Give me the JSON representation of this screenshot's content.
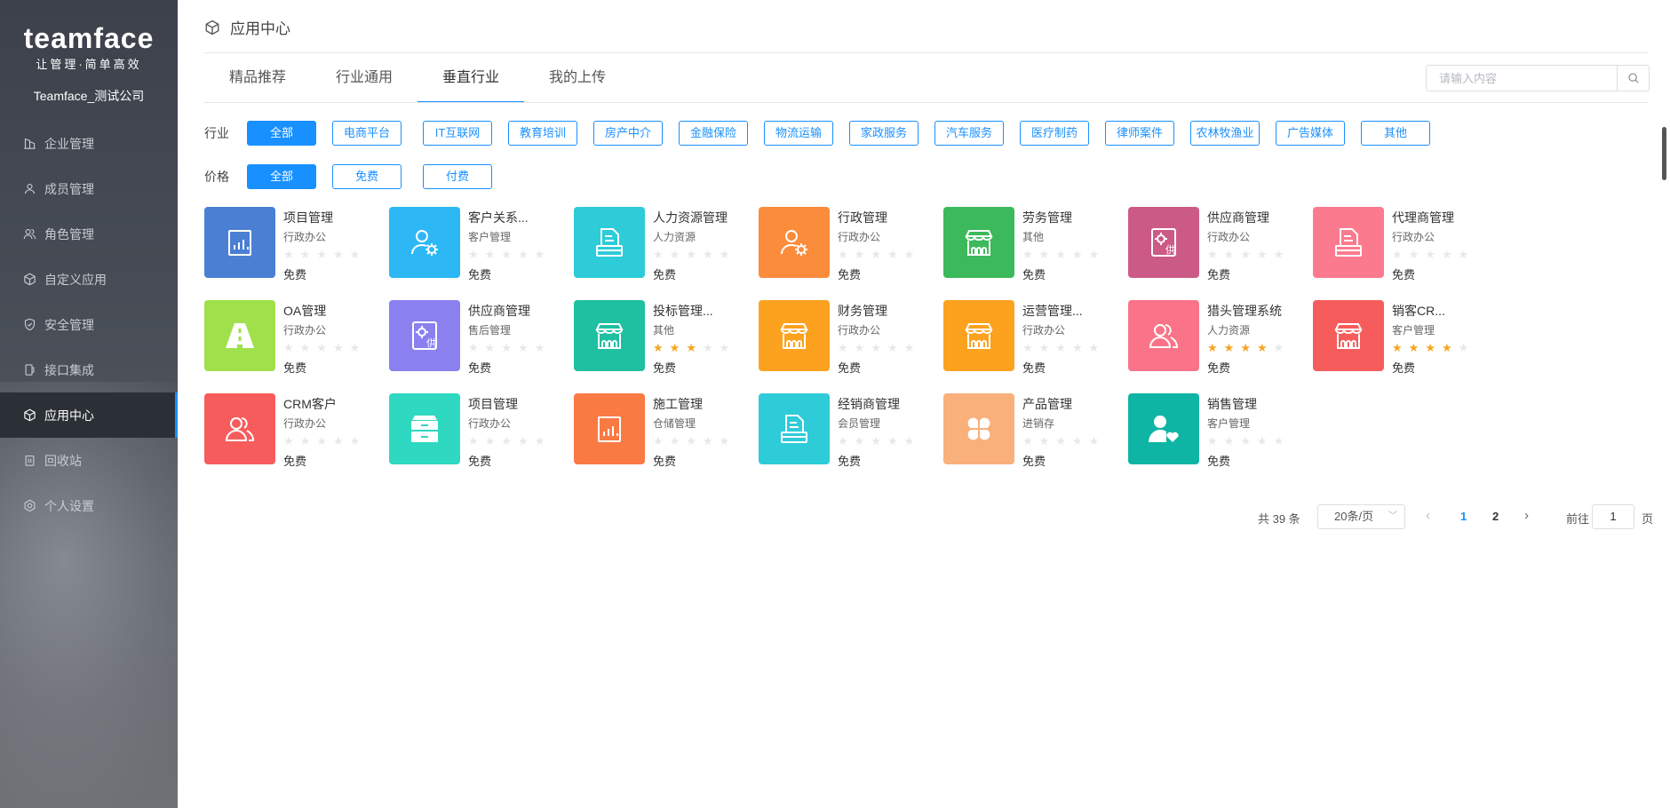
{
  "sidebar": {
    "logo": "teamface",
    "slogan": "让管理·简单高效",
    "company": "Teamface_测试公司",
    "items": [
      {
        "label": "企业管理",
        "icon": "building-icon"
      },
      {
        "label": "成员管理",
        "icon": "user-icon"
      },
      {
        "label": "角色管理",
        "icon": "users-icon"
      },
      {
        "label": "自定义应用",
        "icon": "cube-icon"
      },
      {
        "label": "安全管理",
        "icon": "shield-icon"
      },
      {
        "label": "接口集成",
        "icon": "plug-icon"
      },
      {
        "label": "应用中心",
        "icon": "cube-icon",
        "active": true
      },
      {
        "label": "回收站",
        "icon": "trash-icon"
      },
      {
        "label": "个人设置",
        "icon": "gear-icon"
      }
    ]
  },
  "header": {
    "title": "应用中心",
    "icon": "cube-icon"
  },
  "tabs": [
    "精品推荐",
    "行业通用",
    "垂直行业",
    "我的上传"
  ],
  "active_tab": "垂直行业",
  "search": {
    "placeholder": "请输入内容",
    "icon": "search-icon"
  },
  "filters": {
    "industry_label": "行业",
    "industry_options": [
      "全部",
      "电商平台",
      "IT互联网",
      "教育培训",
      "房产中介",
      "金融保险",
      "物流运输",
      "家政服务",
      "汽车服务",
      "医疗制药",
      "律师案件",
      "农林牧渔业",
      "广告媒体",
      "其他"
    ],
    "industry_selected": "全部",
    "price_label": "价格",
    "price_options": [
      "全部",
      "免费",
      "付费"
    ],
    "price_selected": "全部"
  },
  "apps": [
    {
      "name": "项目管理",
      "category": "行政办公",
      "rating": 0,
      "price": "免费",
      "color": "#4a7fd4",
      "icon": "report-icon"
    },
    {
      "name": "客户关系...",
      "category": "客户管理",
      "rating": 0,
      "price": "免费",
      "color": "#2db7f5",
      "icon": "user-gear-icon"
    },
    {
      "name": "人力资源管理",
      "category": "人力资源",
      "rating": 0,
      "price": "免费",
      "color": "#2ecbd8",
      "icon": "document-icon"
    },
    {
      "name": "行政管理",
      "category": "行政办公",
      "rating": 0,
      "price": "免费",
      "color": "#fa8c3c",
      "icon": "user-gear-icon"
    },
    {
      "name": "劳务管理",
      "category": "其他",
      "rating": 0,
      "price": "免费",
      "color": "#3cb95a",
      "icon": "store-icon"
    },
    {
      "name": "供应商管理",
      "category": "行政办公",
      "rating": 0,
      "price": "免费",
      "color": "#cc5a87",
      "icon": "supplier-icon"
    },
    {
      "name": "代理商管理",
      "category": "行政办公",
      "rating": 0,
      "price": "免费",
      "color": "#fc7a8e",
      "icon": "document-icon"
    },
    {
      "name": "OA管理",
      "category": "行政办公",
      "rating": 0,
      "price": "免费",
      "color": "#a0e04b",
      "icon": "road-icon"
    },
    {
      "name": "供应商管理",
      "category": "售后管理",
      "rating": 0,
      "price": "免费",
      "color": "#8b80f0",
      "icon": "supplier-icon"
    },
    {
      "name": "投标管理...",
      "category": "其他",
      "rating": 3,
      "price": "免费",
      "color": "#1fbfa2",
      "icon": "store-icon"
    },
    {
      "name": "财务管理",
      "category": "行政办公",
      "rating": 0,
      "price": "免费",
      "color": "#fca21e",
      "icon": "store-icon"
    },
    {
      "name": "运营管理...",
      "category": "行政办公",
      "rating": 0,
      "price": "免费",
      "color": "#fca21e",
      "icon": "store-icon"
    },
    {
      "name": "猎头管理系统",
      "category": "人力资源",
      "rating": 4,
      "price": "免费",
      "color": "#fb7388",
      "icon": "users-icon"
    },
    {
      "name": "销客CR...",
      "category": "客户管理",
      "rating": 4,
      "price": "免费",
      "color": "#f75c5c",
      "icon": "store-icon"
    },
    {
      "name": "CRM客户",
      "category": "行政办公",
      "rating": 0,
      "price": "免费",
      "color": "#f75c5c",
      "icon": "users-icon"
    },
    {
      "name": "项目管理",
      "category": "行政办公",
      "rating": 0,
      "price": "免费",
      "color": "#2fd8c0",
      "icon": "cabinet-icon"
    },
    {
      "name": "施工管理",
      "category": "仓储管理",
      "rating": 0,
      "price": "免费",
      "color": "#fa7a44",
      "icon": "report-icon"
    },
    {
      "name": "经销商管理",
      "category": "会员管理",
      "rating": 0,
      "price": "免费",
      "color": "#2ecbd8",
      "icon": "document-icon"
    },
    {
      "name": "产品管理",
      "category": "进销存",
      "rating": 0,
      "price": "免费",
      "color": "#f9b07a",
      "icon": "clover-icon"
    },
    {
      "name": "销售管理",
      "category": "客户管理",
      "rating": 0,
      "price": "免费",
      "color": "#0fb5a4",
      "icon": "user-heart-icon"
    }
  ],
  "pagination": {
    "total": "共 39 条",
    "page_size": "20条/页",
    "pages": [
      "1",
      "2"
    ],
    "current": "1",
    "goto_label": "前往",
    "goto_value": "1",
    "goto_suffix": "页"
  }
}
